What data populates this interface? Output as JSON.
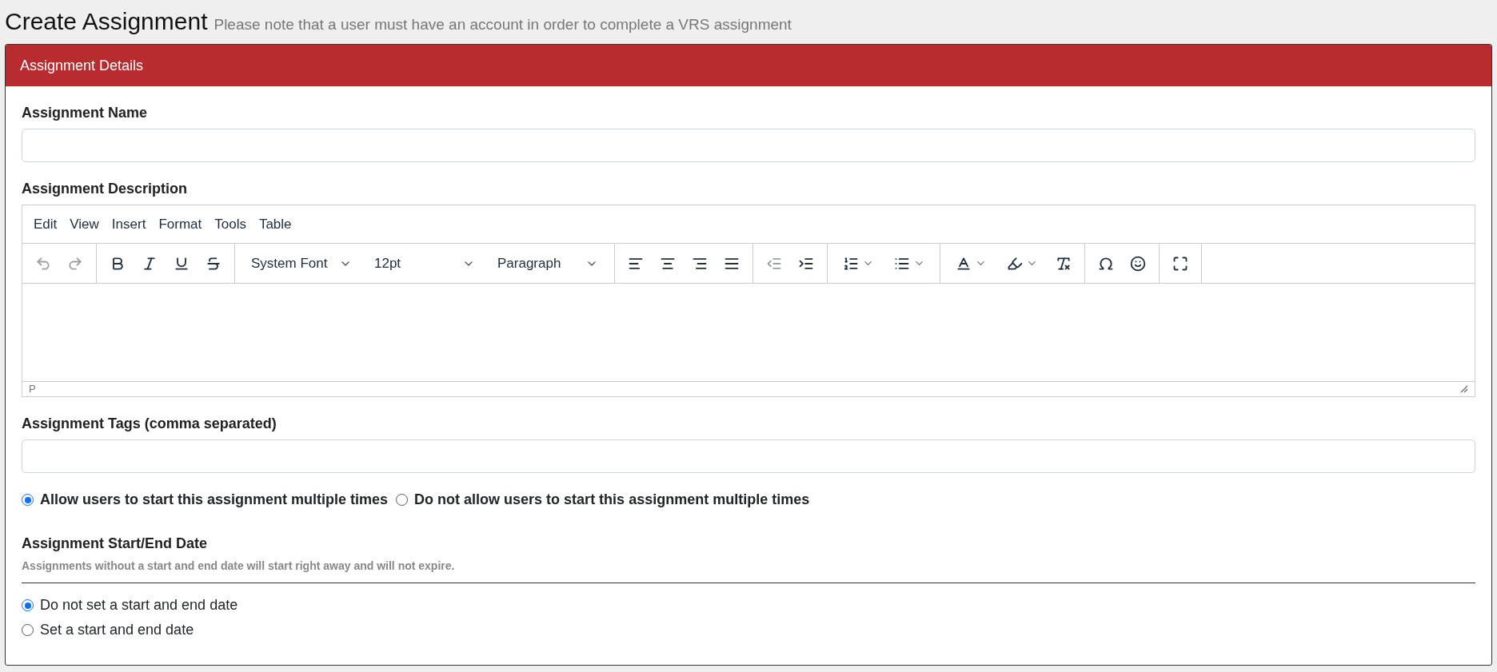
{
  "page": {
    "title": "Create Assignment",
    "note": "Please note that a user must have an account in order to complete a VRS assignment"
  },
  "panel": {
    "header": "Assignment Details"
  },
  "name_field": {
    "label": "Assignment Name"
  },
  "description": {
    "label": "Assignment Description",
    "menus": [
      "Edit",
      "View",
      "Insert",
      "Format",
      "Tools",
      "Table"
    ],
    "toolbar": [
      [
        {
          "kind": "undo",
          "disabled": true
        },
        {
          "kind": "redo",
          "disabled": true
        }
      ],
      [
        {
          "kind": "bold",
          "disabled": false
        },
        {
          "kind": "italic",
          "disabled": false
        },
        {
          "kind": "underline",
          "disabled": false
        },
        {
          "kind": "strikethrough",
          "disabled": false
        }
      ],
      [
        {
          "kind": "select",
          "value": "System Font"
        },
        {
          "kind": "select",
          "value": "12pt"
        },
        {
          "kind": "select",
          "value": "Paragraph"
        }
      ],
      [
        {
          "kind": "align-left",
          "disabled": false
        },
        {
          "kind": "align-center",
          "disabled": false
        },
        {
          "kind": "align-right",
          "disabled": false
        },
        {
          "kind": "align-justify",
          "disabled": false
        }
      ],
      [
        {
          "kind": "outdent",
          "disabled": true
        },
        {
          "kind": "indent",
          "disabled": false
        }
      ],
      [
        {
          "kind": "numbered-list",
          "disabled": false
        },
        {
          "kind": "bullet-list",
          "disabled": false
        }
      ],
      [
        {
          "kind": "text-color",
          "disabled": false
        },
        {
          "kind": "highlight",
          "disabled": false
        },
        {
          "kind": "clear-format",
          "disabled": false
        }
      ],
      [
        {
          "kind": "special-char",
          "disabled": false
        },
        {
          "kind": "emoji",
          "disabled": false
        }
      ],
      [
        {
          "kind": "fullscreen",
          "disabled": false
        }
      ]
    ],
    "status_path": "P"
  },
  "tags_field": {
    "label": "Assignment Tags (comma separated)"
  },
  "repeat_options": [
    {
      "label": "Allow users to start this assignment multiple times",
      "selected": true
    },
    {
      "label": "Do not allow users to start this assignment multiple times",
      "selected": false
    }
  ],
  "dates": {
    "label": "Assignment Start/End Date",
    "hint": "Assignments without a start and end date will start right away and will not expire.",
    "options": [
      {
        "label": "Do not set a start and end date",
        "selected": true
      },
      {
        "label": "Set a start and end date",
        "selected": false
      }
    ]
  }
}
